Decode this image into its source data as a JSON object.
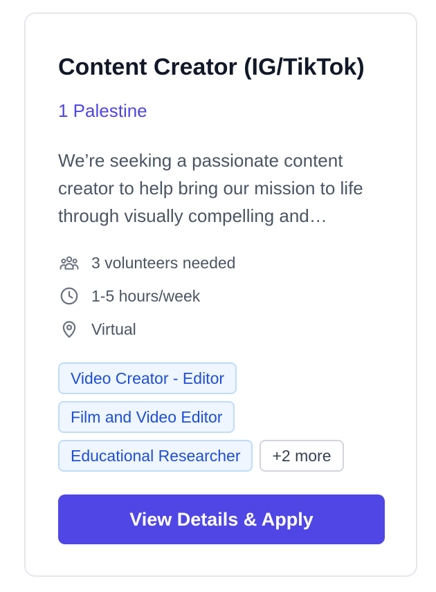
{
  "opportunity": {
    "title": "Content Creator (IG/TikTok)",
    "organization": "1 Palestine",
    "description": "We’re seeking a passionate content creator to help bring our mission to life through visually compelling and engaging content.",
    "meta": {
      "volunteers": {
        "icon": "users-icon",
        "text": "3 volunteers needed"
      },
      "hours": {
        "icon": "clock-icon",
        "text": "1-5 hours/week"
      },
      "location": {
        "icon": "map-pin-icon",
        "text": "Virtual"
      }
    },
    "skills": [
      "Video Creator - Editor",
      "Film and Video Editor",
      "Educational Researcher"
    ],
    "more_skills_label": "+2 more",
    "cta_label": "View Details & Apply"
  },
  "colors": {
    "accent": "#4f46e5",
    "title": "#111827",
    "body_text": "#4b5563",
    "tag_bg": "#eff6ff",
    "tag_border": "#bfdbfe",
    "tag_text": "#1d4ed8",
    "card_border": "#e5e7eb"
  }
}
